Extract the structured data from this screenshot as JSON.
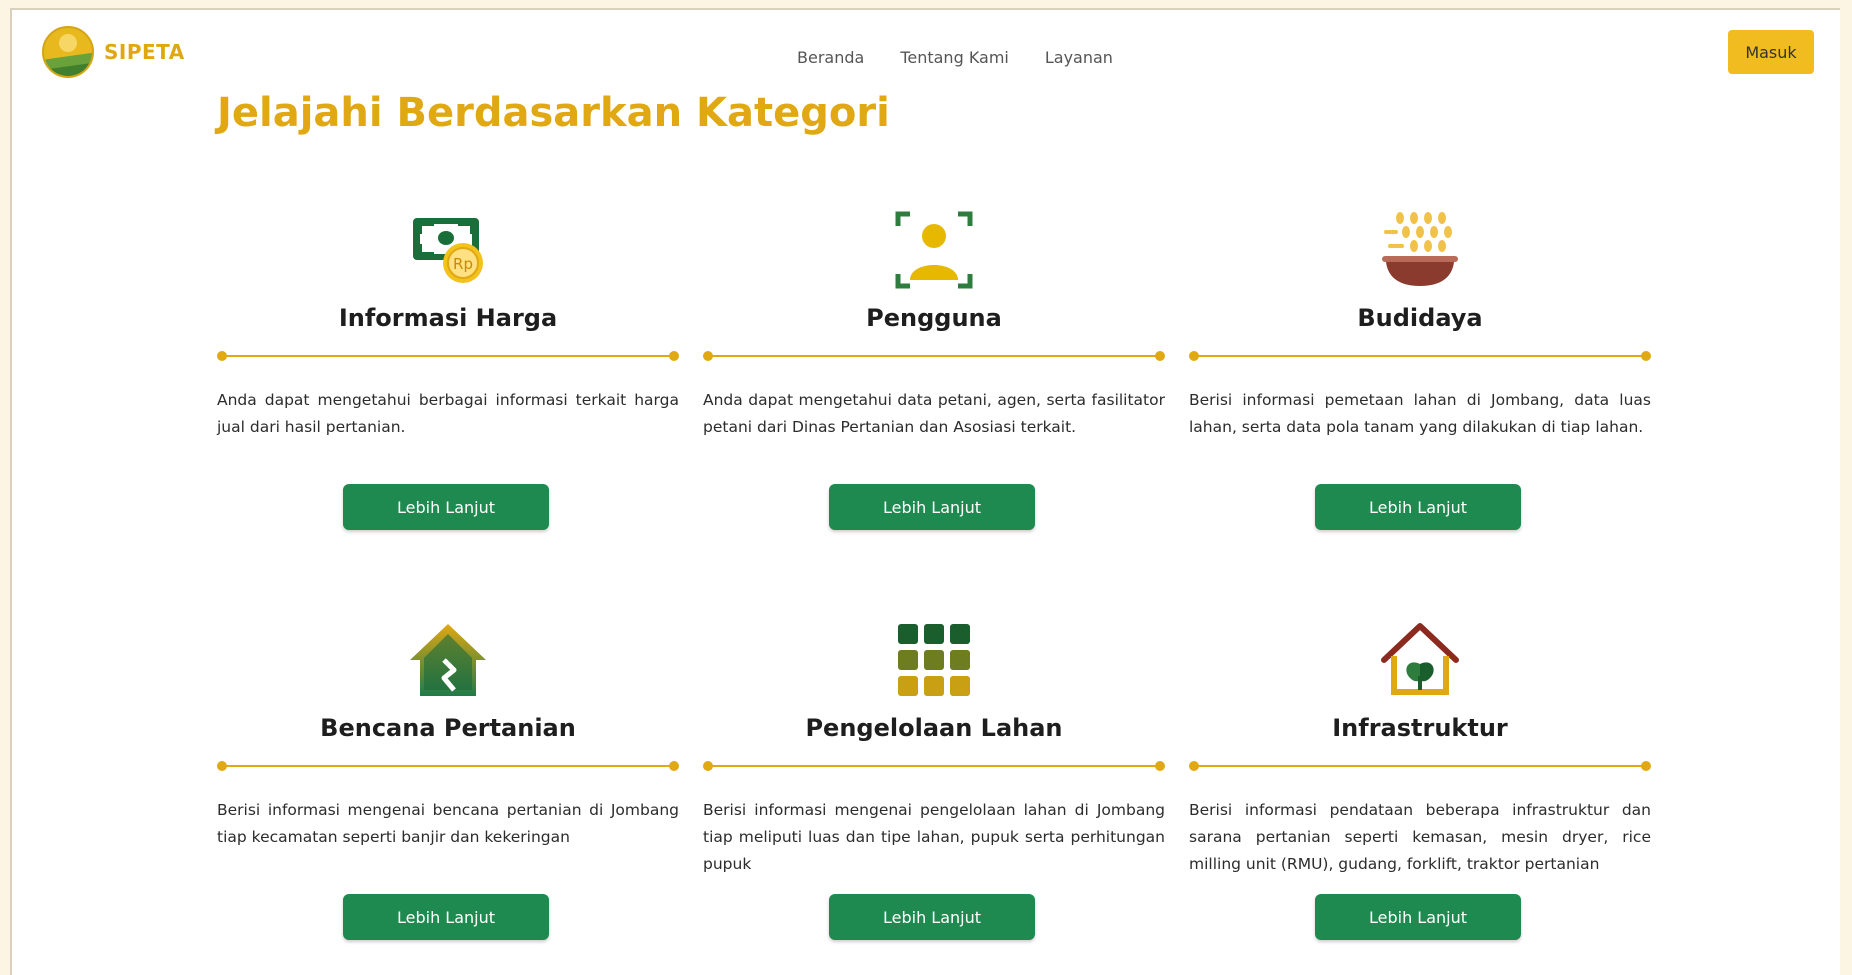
{
  "brand": {
    "name": "SIPETA"
  },
  "nav": {
    "items": [
      "Beranda",
      "Tentang Kami",
      "Layanan"
    ]
  },
  "header": {
    "login_label": "Masuk"
  },
  "main": {
    "heading": "Jelajahi Berdasarkan Kategori"
  },
  "categories": [
    {
      "icon": "money-rp-icon",
      "title": "Informasi Harga",
      "description": "Anda dapat mengetahui berbagai informasi terkait harga jual dari hasil pertanian.",
      "button": "Lebih Lanjut"
    },
    {
      "icon": "user-icon",
      "title": "Pengguna",
      "description": "Anda dapat mengetahui data petani, agen, serta fasilitator petani dari Dinas Pertanian dan Asosiasi terkait.",
      "button": "Lebih Lanjut"
    },
    {
      "icon": "grain-bowl-icon",
      "title": "Budidaya",
      "description": "Berisi informasi pemetaan lahan di Jombang, data luas lahan, serta data pola tanam yang dilakukan di tiap lahan.",
      "button": "Lebih Lanjut"
    },
    {
      "icon": "house-crack-icon",
      "title": "Bencana Pertanian",
      "description": "Berisi informasi mengenai bencana pertanian di Jombang tiap kecamatan seperti banjir dan kekeringan",
      "button": "Lebih Lanjut"
    },
    {
      "icon": "land-grid-icon",
      "title": "Pengelolaan Lahan",
      "description": "Berisi informasi mengenai pengelolaan lahan di Jombang tiap meliputi luas dan tipe lahan, pupuk serta perhitungan pupuk",
      "button": "Lebih Lanjut"
    },
    {
      "icon": "house-plant-icon",
      "title": "Infrastruktur",
      "description": "Berisi informasi pendataan beberapa infrastruktur dan sarana pertanian seperti kemasan, mesin dryer, rice milling unit (RMU), gudang, forklift, traktor pertanian",
      "button": "Lebih Lanjut"
    }
  ],
  "colors": {
    "accent": "#e0a812",
    "button": "#1f8a4f",
    "login": "#f1bc1f"
  }
}
